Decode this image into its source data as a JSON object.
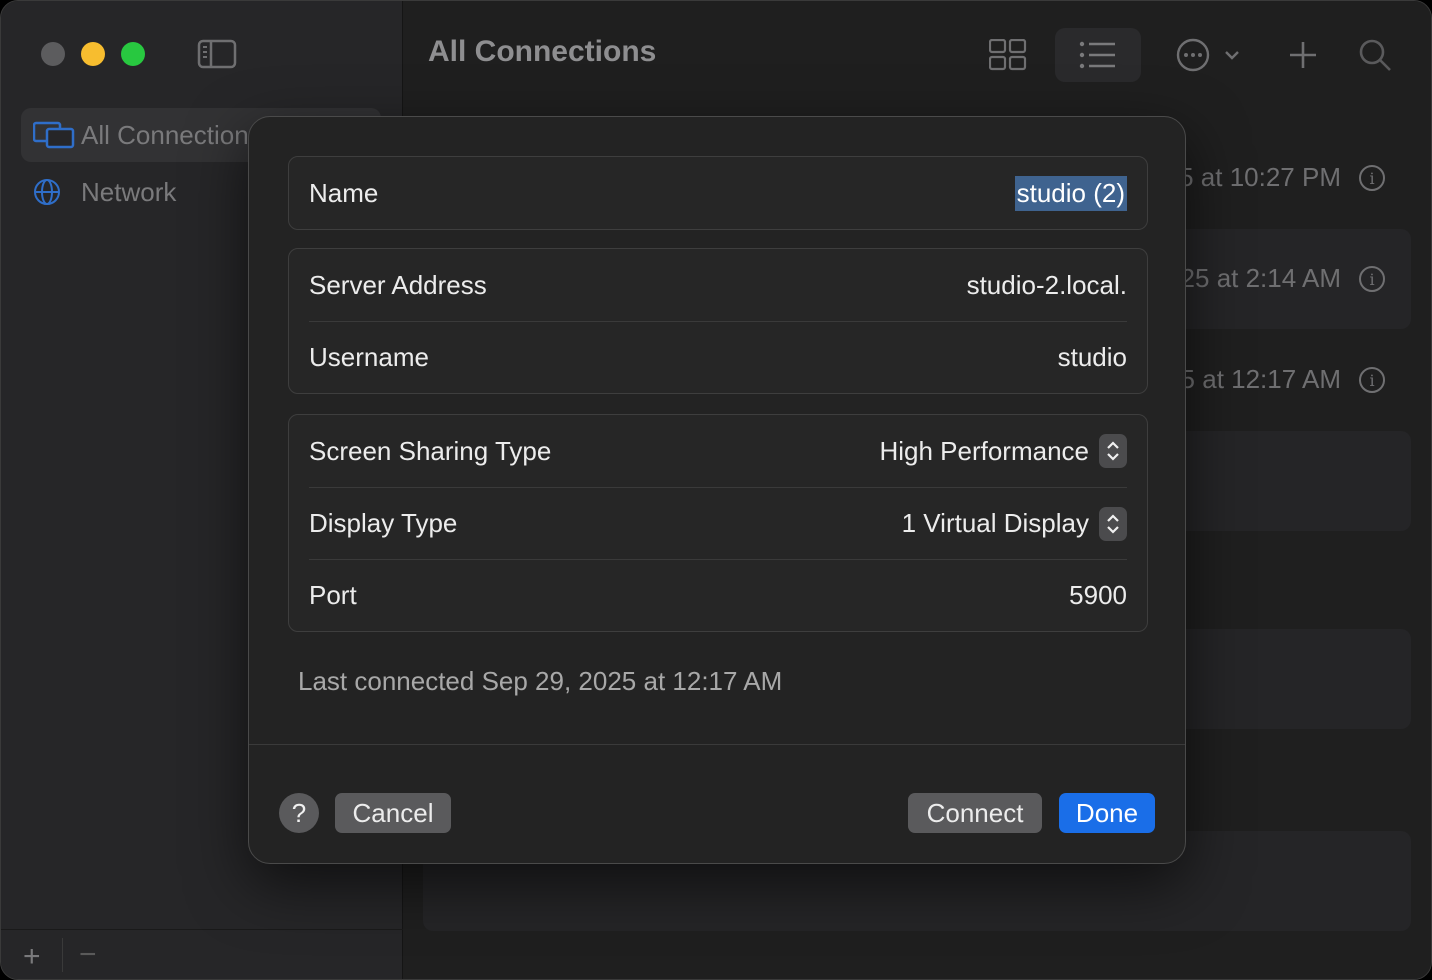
{
  "window": {
    "title": "All Connections"
  },
  "sidebar": {
    "items": [
      {
        "label": "All Connections"
      },
      {
        "label": "Network"
      }
    ],
    "add_label": "+",
    "remove_label": "−"
  },
  "toolbar": {
    "icons": [
      "grid-view-icon",
      "list-view-icon",
      "more-icon",
      "add-icon",
      "search-icon"
    ]
  },
  "connections": [
    {
      "date": "5 at 10:27 PM"
    },
    {
      "date": "25 at 2:14 AM"
    },
    {
      "date": "5 at 12:17 AM"
    }
  ],
  "dialog": {
    "name_label": "Name",
    "name_value": "studio (2)",
    "server_label": "Server Address",
    "server_value": "studio-2.local.",
    "username_label": "Username",
    "username_value": "studio",
    "sharing_type_label": "Screen Sharing Type",
    "sharing_type_value": "High Performance",
    "display_type_label": "Display Type",
    "display_type_value": "1 Virtual Display",
    "port_label": "Port",
    "port_value": "5900",
    "last_connected": "Last connected Sep 29, 2025 at 12:17 AM",
    "help_label": "?",
    "cancel_label": "Cancel",
    "connect_label": "Connect",
    "done_label": "Done"
  },
  "colors": {
    "accent": "#1a6ee8",
    "selection": "#3f638f",
    "close": "#5c5c5e",
    "minimize": "#f7bd2f",
    "maximize": "#28c840"
  }
}
